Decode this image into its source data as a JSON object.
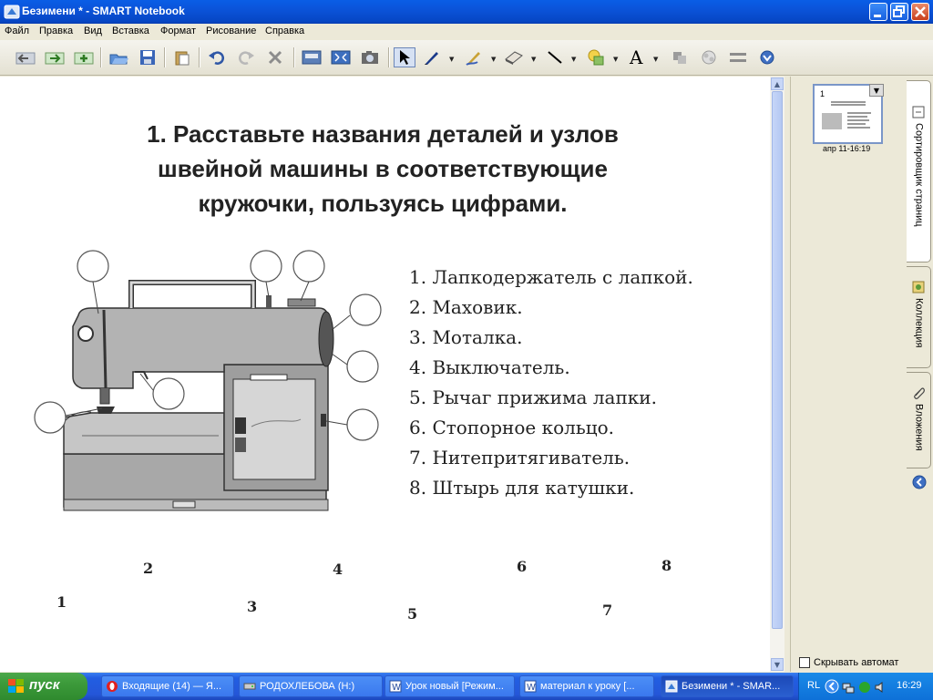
{
  "window": {
    "title": "Безимени * - SMART Notebook",
    "icon": "smart-notebook-icon"
  },
  "menu": [
    "Файл",
    "Правка",
    "Вид",
    "Вставка",
    "Формат",
    "Рисование",
    "Справка"
  ],
  "toolbar": {
    "icons": [
      "previous-page-icon",
      "next-page-icon",
      "add-page-icon",
      "open-icon",
      "save-icon",
      "paste-icon",
      "undo-icon",
      "redo-icon",
      "delete-icon",
      "screen-shade-icon",
      "full-screen-icon",
      "capture-icon",
      "select-icon",
      "pen-icon",
      "creative-pen-icon",
      "eraser-icon",
      "line-icon",
      "shape-icon",
      "text-icon",
      "properties-icon",
      "fill-icon",
      "move-toolbar-icon",
      "more-icon"
    ]
  },
  "page": {
    "title_lines": [
      "1. Расставьте названия деталей и узлов",
      "швейной машины в соответствующие",
      "кружочки, пользуясь цифрами."
    ],
    "parts": [
      "1. Лапкодержатель с лапкой.",
      "2. Маховик.",
      "3. Моталка.",
      "4. Выключатель.",
      "5. Рычаг прижима лапки.",
      "6. Стопорное кольцо.",
      "7. Нитепритягиватель.",
      "8. Штырь для катушки."
    ],
    "draggable_numbers": [
      "1",
      "2",
      "3",
      "4",
      "5",
      "6",
      "7",
      "8"
    ]
  },
  "side_panel": {
    "thumbnail_number": "1",
    "thumbnail_caption": "апр 11-16:19",
    "auto_hide_label": "Скрывать автомат",
    "tabs": [
      "Сортировщик страниц",
      "Коллекция",
      "Вложения"
    ]
  },
  "taskbar": {
    "start_label": "пуск",
    "tasks": [
      {
        "label": "Входящие (14) — Я...",
        "icon": "opera-icon"
      },
      {
        "label": "РОДОХЛЕБОВА (H:)",
        "icon": "drive-icon"
      },
      {
        "label": "Урок новый [Режим...",
        "icon": "word-icon"
      },
      {
        "label": "материал к уроку [...",
        "icon": "word-icon"
      },
      {
        "label": "Безимени * - SMAR...",
        "icon": "smart-notebook-icon"
      }
    ],
    "lang": "RL",
    "clock": "16:29"
  },
  "colors": {
    "titlebar": "#0b53d9",
    "taskbar": "#245edb",
    "start": "#3c9a3a",
    "canvas": "#ffffff"
  }
}
